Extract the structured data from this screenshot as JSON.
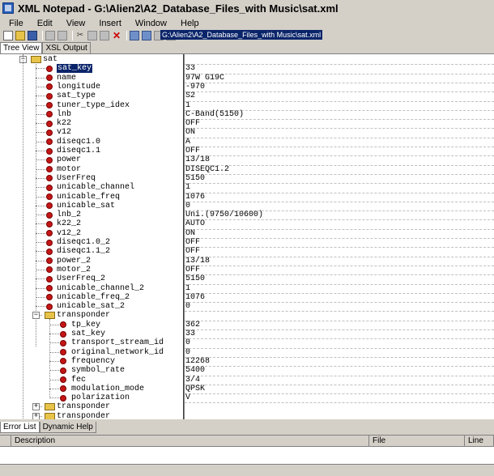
{
  "window": {
    "title": "XML Notepad - G:\\Alien2\\A2_Database_Files_with Music\\sat.xml"
  },
  "menu": [
    "File",
    "Edit",
    "View",
    "Insert",
    "Window",
    "Help"
  ],
  "location": "G:\\Alien2\\A2_Database_Files_with Music\\sat.xml",
  "tabs_top": [
    "Tree View",
    "XSL Output"
  ],
  "tabs_bottom": [
    "Error List",
    "Dynamic Help"
  ],
  "error_list": {
    "columns": [
      "Description",
      "File",
      "Line"
    ]
  },
  "tree": {
    "root": "sat",
    "nodes": [
      {
        "label": "sat_key",
        "value": "33"
      },
      {
        "label": "name",
        "value": "97W G19C"
      },
      {
        "label": "longitude",
        "value": "-970"
      },
      {
        "label": "sat_type",
        "value": "S2"
      },
      {
        "label": "tuner_type_idex",
        "value": "1"
      },
      {
        "label": "lnb",
        "value": "C-Band(5150)"
      },
      {
        "label": "k22",
        "value": "OFF"
      },
      {
        "label": "v12",
        "value": "ON"
      },
      {
        "label": "diseqc1.0",
        "value": "A"
      },
      {
        "label": "diseqc1.1",
        "value": "OFF"
      },
      {
        "label": "power",
        "value": "13/18"
      },
      {
        "label": "motor",
        "value": "DISEQC1.2"
      },
      {
        "label": "UserFreq",
        "value": "5150"
      },
      {
        "label": "unicable_channel",
        "value": "1"
      },
      {
        "label": "unicable_freq",
        "value": "1076"
      },
      {
        "label": "unicable_sat",
        "value": "0"
      },
      {
        "label": "lnb_2",
        "value": "Uni.(9750/10600)"
      },
      {
        "label": "k22_2",
        "value": "AUTO"
      },
      {
        "label": "v12_2",
        "value": "ON"
      },
      {
        "label": "diseqc1.0_2",
        "value": "OFF"
      },
      {
        "label": "diseqc1.1_2",
        "value": "OFF"
      },
      {
        "label": "power_2",
        "value": "13/18"
      },
      {
        "label": "motor_2",
        "value": "OFF"
      },
      {
        "label": "UserFreq_2",
        "value": "5150"
      },
      {
        "label": "unicable_channel_2",
        "value": "1"
      },
      {
        "label": "unicable_freq_2",
        "value": "1076"
      },
      {
        "label": "unicable_sat_2",
        "value": "0"
      }
    ],
    "transponder_expanded": {
      "label": "transponder",
      "children": [
        {
          "label": "tp_key",
          "value": "362"
        },
        {
          "label": "sat_key",
          "value": "33"
        },
        {
          "label": "transport_stream_id",
          "value": "0"
        },
        {
          "label": "original_network_id",
          "value": "0"
        },
        {
          "label": "frequency",
          "value": "12268"
        },
        {
          "label": "symbol_rate",
          "value": "5400"
        },
        {
          "label": "fec",
          "value": "3/4"
        },
        {
          "label": "modulation_mode",
          "value": "QPSK"
        },
        {
          "label": "polarization",
          "value": "V"
        }
      ]
    },
    "collapsed": [
      "transponder",
      "transponder"
    ]
  }
}
